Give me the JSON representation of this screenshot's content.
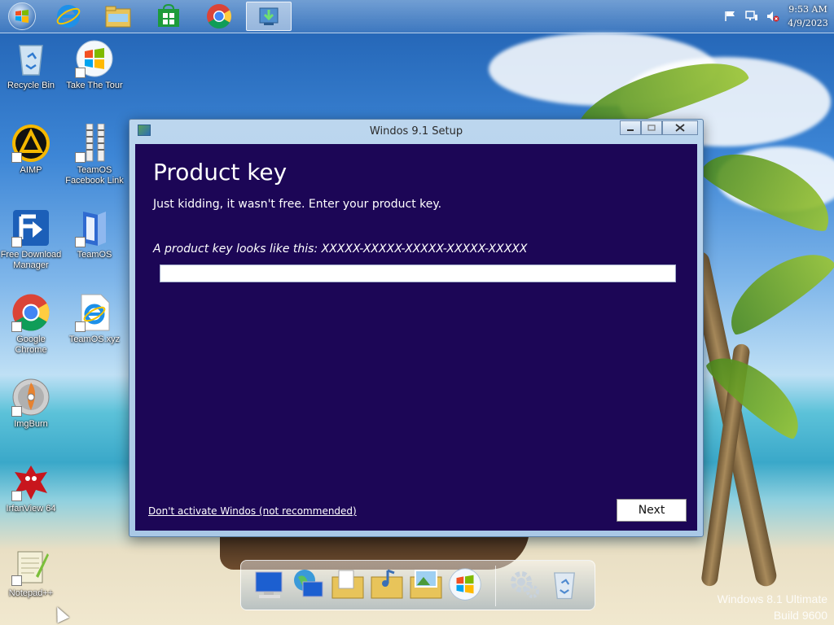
{
  "taskbar": {
    "items": [
      {
        "name": "internet-explorer",
        "icon": "ie-icon"
      },
      {
        "name": "file-explorer",
        "icon": "folder-icon"
      },
      {
        "name": "store",
        "icon": "store-icon"
      },
      {
        "name": "google-chrome",
        "icon": "chrome-icon"
      },
      {
        "name": "windos-setup",
        "icon": "setup-icon",
        "active": true
      }
    ],
    "clock": {
      "time": "9:53 AM",
      "date": "4/9/2023"
    }
  },
  "desktop": {
    "icons": [
      {
        "label": "Recycle Bin",
        "icon": "recycle-bin-icon"
      },
      {
        "label": "Take The Tour",
        "icon": "windows-orb-icon"
      },
      {
        "label": "AIMP",
        "icon": "aimp-icon"
      },
      {
        "label": "TeamOS Facebook Link",
        "icon": "zipper-icon"
      },
      {
        "label": "Free Download Manager",
        "icon": "fdm-icon"
      },
      {
        "label": "TeamOS",
        "icon": "book-icon"
      },
      {
        "label": "Google Chrome",
        "icon": "chrome-icon"
      },
      {
        "label": "TeamOS.xyz",
        "icon": "ie-document-icon"
      },
      {
        "label": "ImgBurn",
        "icon": "disc-icon"
      },
      {
        "label": "IrfanView 64",
        "icon": "irfanview-icon"
      },
      {
        "label": "Notepad++",
        "icon": "notepad-icon"
      }
    ]
  },
  "setup": {
    "title": "Windos 9.1 Setup",
    "heading": "Product key",
    "subtitle": "Just kidding, it wasn't free. Enter your product key.",
    "hint": "A product key looks like this: XXXXX-XXXXX-XXXXX-XXXXX-XXXXX",
    "key_value": "",
    "skip_link": "Don't activate Windos (not recommended)",
    "next_label": "Next",
    "colors": {
      "client_bg": "#1c0656",
      "text": "#ffffff"
    }
  },
  "watermark": {
    "line1": "Windows 8.1 Ultimate",
    "line2": "Build 9600"
  }
}
